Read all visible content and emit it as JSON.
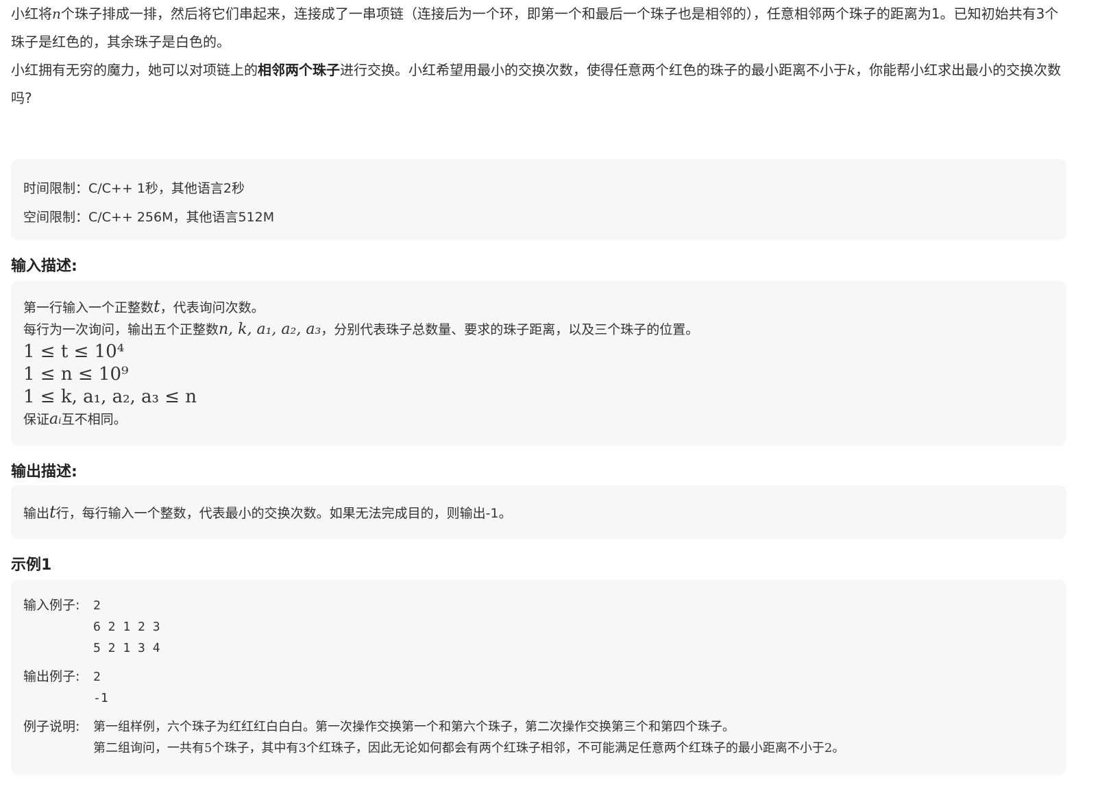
{
  "description": {
    "line1_a": "小红将",
    "var_n": "n",
    "line1_b": "个珠子排成一排，然后将它们串起来，连接成了一串项链（连接后为一个环，即第一个和最后一个珠子也是相邻的），任意相邻两个珠子的距离为1。已知初始共有3个珠子是红色的，其余珠子是白色的。",
    "line2_a": "小红拥有无穷的魔力，她可以对项链上的",
    "line2_bold": "相邻两个珠子",
    "line2_b": "进行交换。小红希望用最小的交换次数，使得任意两个红色的珠子的最小距离不小于",
    "var_k": "k",
    "line2_c": "，你能帮小红求出最小的交换次数吗?"
  },
  "limits": {
    "time": "时间限制：C/C++ 1秒，其他语言2秒",
    "space": "空间限制：C/C++ 256M，其他语言512M"
  },
  "input": {
    "heading": "输入描述:",
    "l1_a": "第一行输入一个正整数",
    "l1_var": "t",
    "l1_b": "，代表询问次数。",
    "l2_a": "每行为一次询问，输出五个正整数",
    "l2_var": "n, k, a₁, a₂, a₃",
    "l2_b": "，分别代表珠子总数量、要求的珠子距离，以及三个珠子的位置。",
    "c1": "1 ≤ t ≤ 10⁴",
    "c2": "1 ≤ n ≤ 10⁹",
    "c3": "1 ≤ k, a₁, a₂, a₃ ≤ n",
    "l3_a": "保证",
    "l3_var": "aᵢ",
    "l3_b": "互不相同。"
  },
  "output": {
    "heading": "输出描述:",
    "a": "输出",
    "var": "t",
    "b": "行，每行输入一个整数，代表最小的交换次数。如果无法完成目的，则输出-1。"
  },
  "example": {
    "heading": "示例1",
    "input_label": "输入例子:",
    "input_lines": [
      "2",
      "6 2 1 2 3",
      "5 2 1 3 4"
    ],
    "output_label": "输出例子:",
    "output_lines": [
      "2",
      "-1"
    ],
    "explain_label": "例子说明:",
    "explain_lines": [
      "第一组样例，六个珠子为红红红白白白。第一次操作交换第一个和第六个珠子，第二次操作交换第三个和第四个珠子。",
      "第二组询问，一共有5个珠子，其中有3个红珠子，因此无论如何都会有两个红珠子相邻，不可能满足任意两个红珠子的最小距离不小于2。"
    ]
  }
}
